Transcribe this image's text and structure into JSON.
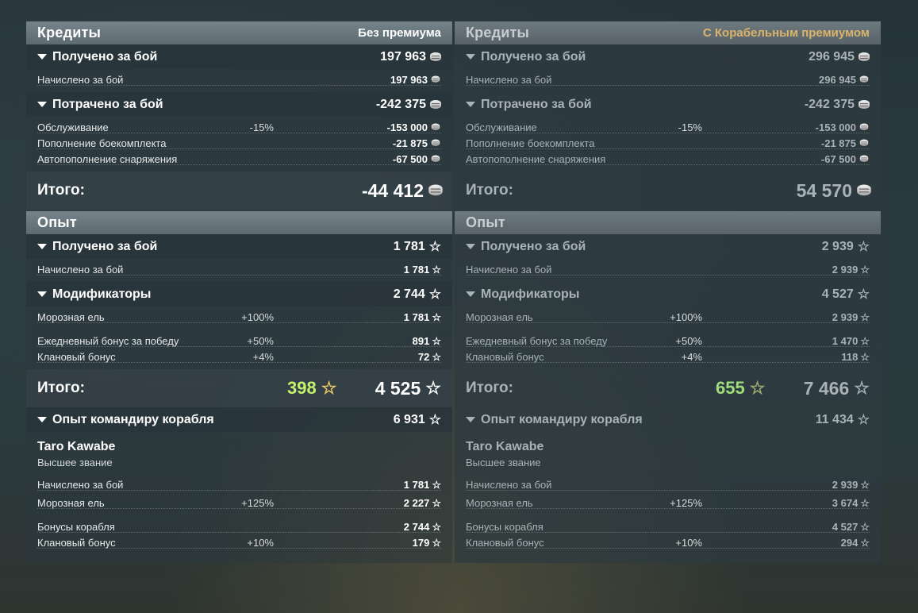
{
  "left": {
    "credits_header": {
      "title": "Кредиты",
      "right": "Без премиума"
    },
    "credits_earned": {
      "label": "Получено за бой",
      "value": "197 963",
      "rows": [
        {
          "label": "Начислено за бой",
          "mod": "",
          "value": "197 963"
        }
      ]
    },
    "credits_spent": {
      "label": "Потрачено за бой",
      "value": "-242 375",
      "rows": [
        {
          "label": "Обслуживание",
          "mod": "-15%",
          "value": "-153 000"
        },
        {
          "label": "Пополнение боекомплекта",
          "mod": "",
          "value": "-21 875"
        },
        {
          "label": "Автопополнение снаряжения",
          "mod": "",
          "value": "-67 500"
        }
      ]
    },
    "credits_total": {
      "label": "Итого:",
      "value": "-44 412"
    },
    "xp_header": {
      "title": "Опыт"
    },
    "xp_earned": {
      "label": "Получено за бой",
      "value": "1 781",
      "rows": [
        {
          "label": "Начислено за бой",
          "mod": "",
          "value": "1 781"
        }
      ]
    },
    "modifiers": {
      "label": "Модификаторы",
      "value": "2 744",
      "rows": [
        {
          "label": "Морозная ель",
          "mod": "+100%",
          "value": "1 781"
        },
        {
          "label": "Ежедневный бонус за победу",
          "mod": "+50%",
          "value": "891"
        },
        {
          "label": "Клановый бонус",
          "mod": "+4%",
          "value": "72"
        }
      ]
    },
    "xp_total": {
      "label": "Итого:",
      "bonus": "398",
      "value": "4 525"
    },
    "commander": {
      "label": "Опыт командиру корабля",
      "value": "6 931",
      "name": "Taro Kawabe",
      "rank": "Высшее звание",
      "rows": [
        {
          "label": "Начислено за бой",
          "mod": "",
          "value": "1 781"
        },
        {
          "label": "Морозная ель",
          "mod": "+125%",
          "value": "2 227"
        },
        {
          "label": "Бонусы корабля",
          "mod": "",
          "value": "2 744"
        },
        {
          "label": "Клановый бонус",
          "mod": "+10%",
          "value": "179"
        }
      ]
    }
  },
  "right": {
    "credits_header": {
      "title": "Кредиты",
      "right": "С Корабельным премиумом"
    },
    "credits_earned": {
      "label": "Получено за бой",
      "value": "296 945",
      "rows": [
        {
          "label": "Начислено за бой",
          "mod": "",
          "value": "296 945"
        }
      ]
    },
    "credits_spent": {
      "label": "Потрачено за бой",
      "value": "-242 375",
      "rows": [
        {
          "label": "Обслуживание",
          "mod": "-15%",
          "value": "-153 000"
        },
        {
          "label": "Пополнение боекомплекта",
          "mod": "",
          "value": "-21 875"
        },
        {
          "label": "Автопополнение снаряжения",
          "mod": "",
          "value": "-67 500"
        }
      ]
    },
    "credits_total": {
      "label": "Итого:",
      "value": "54 570"
    },
    "xp_header": {
      "title": "Опыт"
    },
    "xp_earned": {
      "label": "Получено за бой",
      "value": "2 939",
      "rows": [
        {
          "label": "Начислено за бой",
          "mod": "",
          "value": "2 939"
        }
      ]
    },
    "modifiers": {
      "label": "Модификаторы",
      "value": "4 527",
      "rows": [
        {
          "label": "Морозная ель",
          "mod": "+100%",
          "value": "2 939"
        },
        {
          "label": "Ежедневный бонус за победу",
          "mod": "+50%",
          "value": "1 470"
        },
        {
          "label": "Клановый бонус",
          "mod": "+4%",
          "value": "118"
        }
      ]
    },
    "xp_total": {
      "label": "Итого:",
      "bonus": "655",
      "value": "7 466"
    },
    "commander": {
      "label": "Опыт командиру корабля",
      "value": "11 434",
      "name": "Taro Kawabe",
      "rank": "Высшее звание",
      "rows": [
        {
          "label": "Начислено за бой",
          "mod": "",
          "value": "2 939"
        },
        {
          "label": "Морозная ель",
          "mod": "+125%",
          "value": "3 674"
        },
        {
          "label": "Бонусы корабля",
          "mod": "",
          "value": "4 527"
        },
        {
          "label": "Клановый бонус",
          "mod": "+10%",
          "value": "294"
        }
      ]
    }
  },
  "colors": {
    "premium_text": "#d9b46a",
    "bonus_xp": "#c6f06e"
  },
  "icons": {
    "credits": "credits-coin-icon",
    "xp": "xp-star-icon",
    "expand": "triangle-down-icon"
  }
}
